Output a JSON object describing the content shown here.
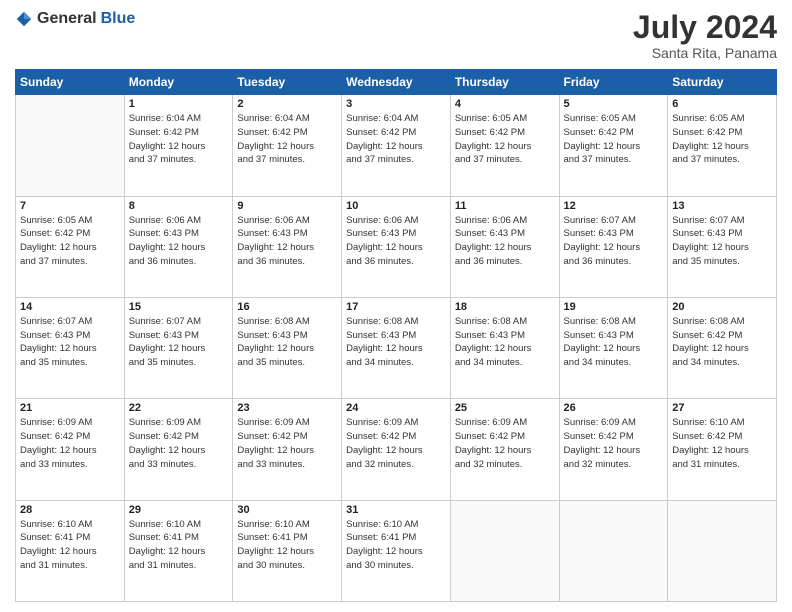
{
  "header": {
    "logo_general": "General",
    "logo_blue": "Blue",
    "month_year": "July 2024",
    "location": "Santa Rita, Panama"
  },
  "days_of_week": [
    "Sunday",
    "Monday",
    "Tuesday",
    "Wednesday",
    "Thursday",
    "Friday",
    "Saturday"
  ],
  "weeks": [
    [
      {
        "day": "",
        "info": ""
      },
      {
        "day": "1",
        "info": "Sunrise: 6:04 AM\nSunset: 6:42 PM\nDaylight: 12 hours\nand 37 minutes."
      },
      {
        "day": "2",
        "info": "Sunrise: 6:04 AM\nSunset: 6:42 PM\nDaylight: 12 hours\nand 37 minutes."
      },
      {
        "day": "3",
        "info": "Sunrise: 6:04 AM\nSunset: 6:42 PM\nDaylight: 12 hours\nand 37 minutes."
      },
      {
        "day": "4",
        "info": "Sunrise: 6:05 AM\nSunset: 6:42 PM\nDaylight: 12 hours\nand 37 minutes."
      },
      {
        "day": "5",
        "info": "Sunrise: 6:05 AM\nSunset: 6:42 PM\nDaylight: 12 hours\nand 37 minutes."
      },
      {
        "day": "6",
        "info": "Sunrise: 6:05 AM\nSunset: 6:42 PM\nDaylight: 12 hours\nand 37 minutes."
      }
    ],
    [
      {
        "day": "7",
        "info": "Sunrise: 6:05 AM\nSunset: 6:42 PM\nDaylight: 12 hours\nand 37 minutes."
      },
      {
        "day": "8",
        "info": "Sunrise: 6:06 AM\nSunset: 6:43 PM\nDaylight: 12 hours\nand 36 minutes."
      },
      {
        "day": "9",
        "info": "Sunrise: 6:06 AM\nSunset: 6:43 PM\nDaylight: 12 hours\nand 36 minutes."
      },
      {
        "day": "10",
        "info": "Sunrise: 6:06 AM\nSunset: 6:43 PM\nDaylight: 12 hours\nand 36 minutes."
      },
      {
        "day": "11",
        "info": "Sunrise: 6:06 AM\nSunset: 6:43 PM\nDaylight: 12 hours\nand 36 minutes."
      },
      {
        "day": "12",
        "info": "Sunrise: 6:07 AM\nSunset: 6:43 PM\nDaylight: 12 hours\nand 36 minutes."
      },
      {
        "day": "13",
        "info": "Sunrise: 6:07 AM\nSunset: 6:43 PM\nDaylight: 12 hours\nand 35 minutes."
      }
    ],
    [
      {
        "day": "14",
        "info": "Sunrise: 6:07 AM\nSunset: 6:43 PM\nDaylight: 12 hours\nand 35 minutes."
      },
      {
        "day": "15",
        "info": "Sunrise: 6:07 AM\nSunset: 6:43 PM\nDaylight: 12 hours\nand 35 minutes."
      },
      {
        "day": "16",
        "info": "Sunrise: 6:08 AM\nSunset: 6:43 PM\nDaylight: 12 hours\nand 35 minutes."
      },
      {
        "day": "17",
        "info": "Sunrise: 6:08 AM\nSunset: 6:43 PM\nDaylight: 12 hours\nand 34 minutes."
      },
      {
        "day": "18",
        "info": "Sunrise: 6:08 AM\nSunset: 6:43 PM\nDaylight: 12 hours\nand 34 minutes."
      },
      {
        "day": "19",
        "info": "Sunrise: 6:08 AM\nSunset: 6:43 PM\nDaylight: 12 hours\nand 34 minutes."
      },
      {
        "day": "20",
        "info": "Sunrise: 6:08 AM\nSunset: 6:42 PM\nDaylight: 12 hours\nand 34 minutes."
      }
    ],
    [
      {
        "day": "21",
        "info": "Sunrise: 6:09 AM\nSunset: 6:42 PM\nDaylight: 12 hours\nand 33 minutes."
      },
      {
        "day": "22",
        "info": "Sunrise: 6:09 AM\nSunset: 6:42 PM\nDaylight: 12 hours\nand 33 minutes."
      },
      {
        "day": "23",
        "info": "Sunrise: 6:09 AM\nSunset: 6:42 PM\nDaylight: 12 hours\nand 33 minutes."
      },
      {
        "day": "24",
        "info": "Sunrise: 6:09 AM\nSunset: 6:42 PM\nDaylight: 12 hours\nand 32 minutes."
      },
      {
        "day": "25",
        "info": "Sunrise: 6:09 AM\nSunset: 6:42 PM\nDaylight: 12 hours\nand 32 minutes."
      },
      {
        "day": "26",
        "info": "Sunrise: 6:09 AM\nSunset: 6:42 PM\nDaylight: 12 hours\nand 32 minutes."
      },
      {
        "day": "27",
        "info": "Sunrise: 6:10 AM\nSunset: 6:42 PM\nDaylight: 12 hours\nand 31 minutes."
      }
    ],
    [
      {
        "day": "28",
        "info": "Sunrise: 6:10 AM\nSunset: 6:41 PM\nDaylight: 12 hours\nand 31 minutes."
      },
      {
        "day": "29",
        "info": "Sunrise: 6:10 AM\nSunset: 6:41 PM\nDaylight: 12 hours\nand 31 minutes."
      },
      {
        "day": "30",
        "info": "Sunrise: 6:10 AM\nSunset: 6:41 PM\nDaylight: 12 hours\nand 30 minutes."
      },
      {
        "day": "31",
        "info": "Sunrise: 6:10 AM\nSunset: 6:41 PM\nDaylight: 12 hours\nand 30 minutes."
      },
      {
        "day": "",
        "info": ""
      },
      {
        "day": "",
        "info": ""
      },
      {
        "day": "",
        "info": ""
      }
    ]
  ]
}
